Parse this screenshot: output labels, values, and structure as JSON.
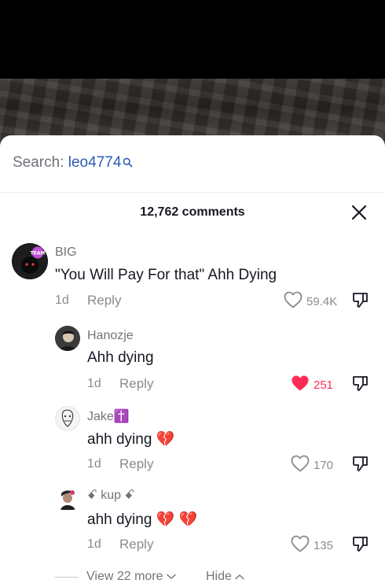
{
  "search": {
    "label": "Search:",
    "term": "leo4774"
  },
  "comments_header": {
    "count_label": "12,762 comments"
  },
  "comments": [
    {
      "username": "BIG",
      "text": "\"You Will Pay For that\" Ahh Dying",
      "age": "1d",
      "reply_label": "Reply",
      "likes": "59.4K",
      "liked": false,
      "avatar_badge": "TEAM"
    },
    {
      "username": "Hanozje",
      "text": "Ahh dying",
      "age": "1d",
      "reply_label": "Reply",
      "likes": "251",
      "liked": true
    },
    {
      "username": "Jake✝️",
      "text": "ahh dying 💔",
      "age": "1d",
      "reply_label": "Reply",
      "likes": "170",
      "liked": false
    },
    {
      "username": "ꗃ kup ꗃ",
      "text": "ahh dying 💔 💔",
      "age": "1d",
      "reply_label": "Reply",
      "likes": "135",
      "liked": false
    }
  ],
  "replies_footer": {
    "view_more_label": "View 22 more",
    "hide_label": "Hide"
  },
  "colors": {
    "accent_like": "#fe2c55",
    "search_link": "#2b5bb5",
    "muted_text": "#8a8b91"
  }
}
